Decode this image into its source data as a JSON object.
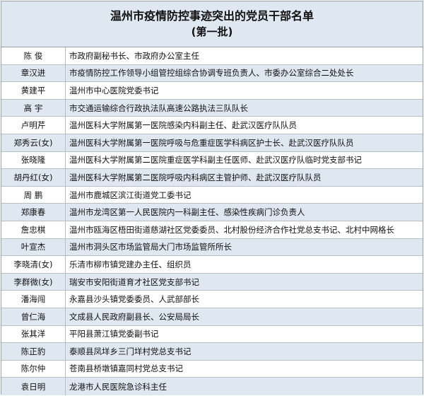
{
  "header": {
    "title": "温州市疫情防控事迹突出的党员干部名单",
    "subtitle": "(第一批)"
  },
  "rows": [
    {
      "name": "陈  俊",
      "position": "市政府副秘书长、市政府办公室主任"
    },
    {
      "name": "章汉进",
      "position": "市疫情防控工作领导小组管控组综合协调专班负责人、市委办公室综合二处处长"
    },
    {
      "name": "黄建平",
      "position": "温州市中心医院党委书记"
    },
    {
      "name": "高  宇",
      "position": "市交通运输综合行政执法队高速公路执法三队队长"
    },
    {
      "name": "卢明芹",
      "position": "温州医科大学附属第一医院感染内科副主任、赴武汉医疗队队员"
    },
    {
      "name": "郑秀云(女)",
      "position": "温州医科大学附属第一医院呼吸与危重症医学科病区护士长、赴武汉医疗队队员"
    },
    {
      "name": "张晓隆",
      "position": "温州医科大学附属第二医院重症医学科副主任医师、赴武汉医疗队临时党支部书记"
    },
    {
      "name": "胡丹红(女)",
      "position": "温州医科大学附属第二医院呼吸内科病区主管护师、赴武汉医疗队队员"
    },
    {
      "name": "周  鹏",
      "position": "温州市鹿城区滨江街道党工委书记"
    },
    {
      "name": "郑康春",
      "position": "温州市龙湾区第一人民医院内一科副主任、感染性疾病门诊负责人"
    },
    {
      "name": "詹忠棋",
      "position": "温州市瓯海区梧田街道慈湖社区党委委员、北村股份经济合作社党总支书记、北村中网格长"
    },
    {
      "name": "叶宣杰",
      "position": "温州市洞头区市场监管局大门市场监管所所长"
    },
    {
      "name": "李晓清(女)",
      "position": "乐清市柳市镇党建办主任、组织员"
    },
    {
      "name": "李群微(女)",
      "position": "瑞安市安阳街道育才社区党支部书记"
    },
    {
      "name": "潘海闯",
      "position": "永嘉县沙头镇党委委员、人武部部长"
    },
    {
      "name": "曾仁海",
      "position": "文成县人民政府副县长、公安局局长"
    },
    {
      "name": "张其洋",
      "position": "平阳县萧江镇党委副书记"
    },
    {
      "name": "陈正豹",
      "position": "泰顺县凤垟乡三门垟村党总支书记"
    },
    {
      "name": "陈尔仲",
      "position": "苍南县桥墩镇嘉同村党总支书记"
    },
    {
      "name": "袁日明",
      "position": "龙港市人民医院急诊科主任"
    }
  ]
}
